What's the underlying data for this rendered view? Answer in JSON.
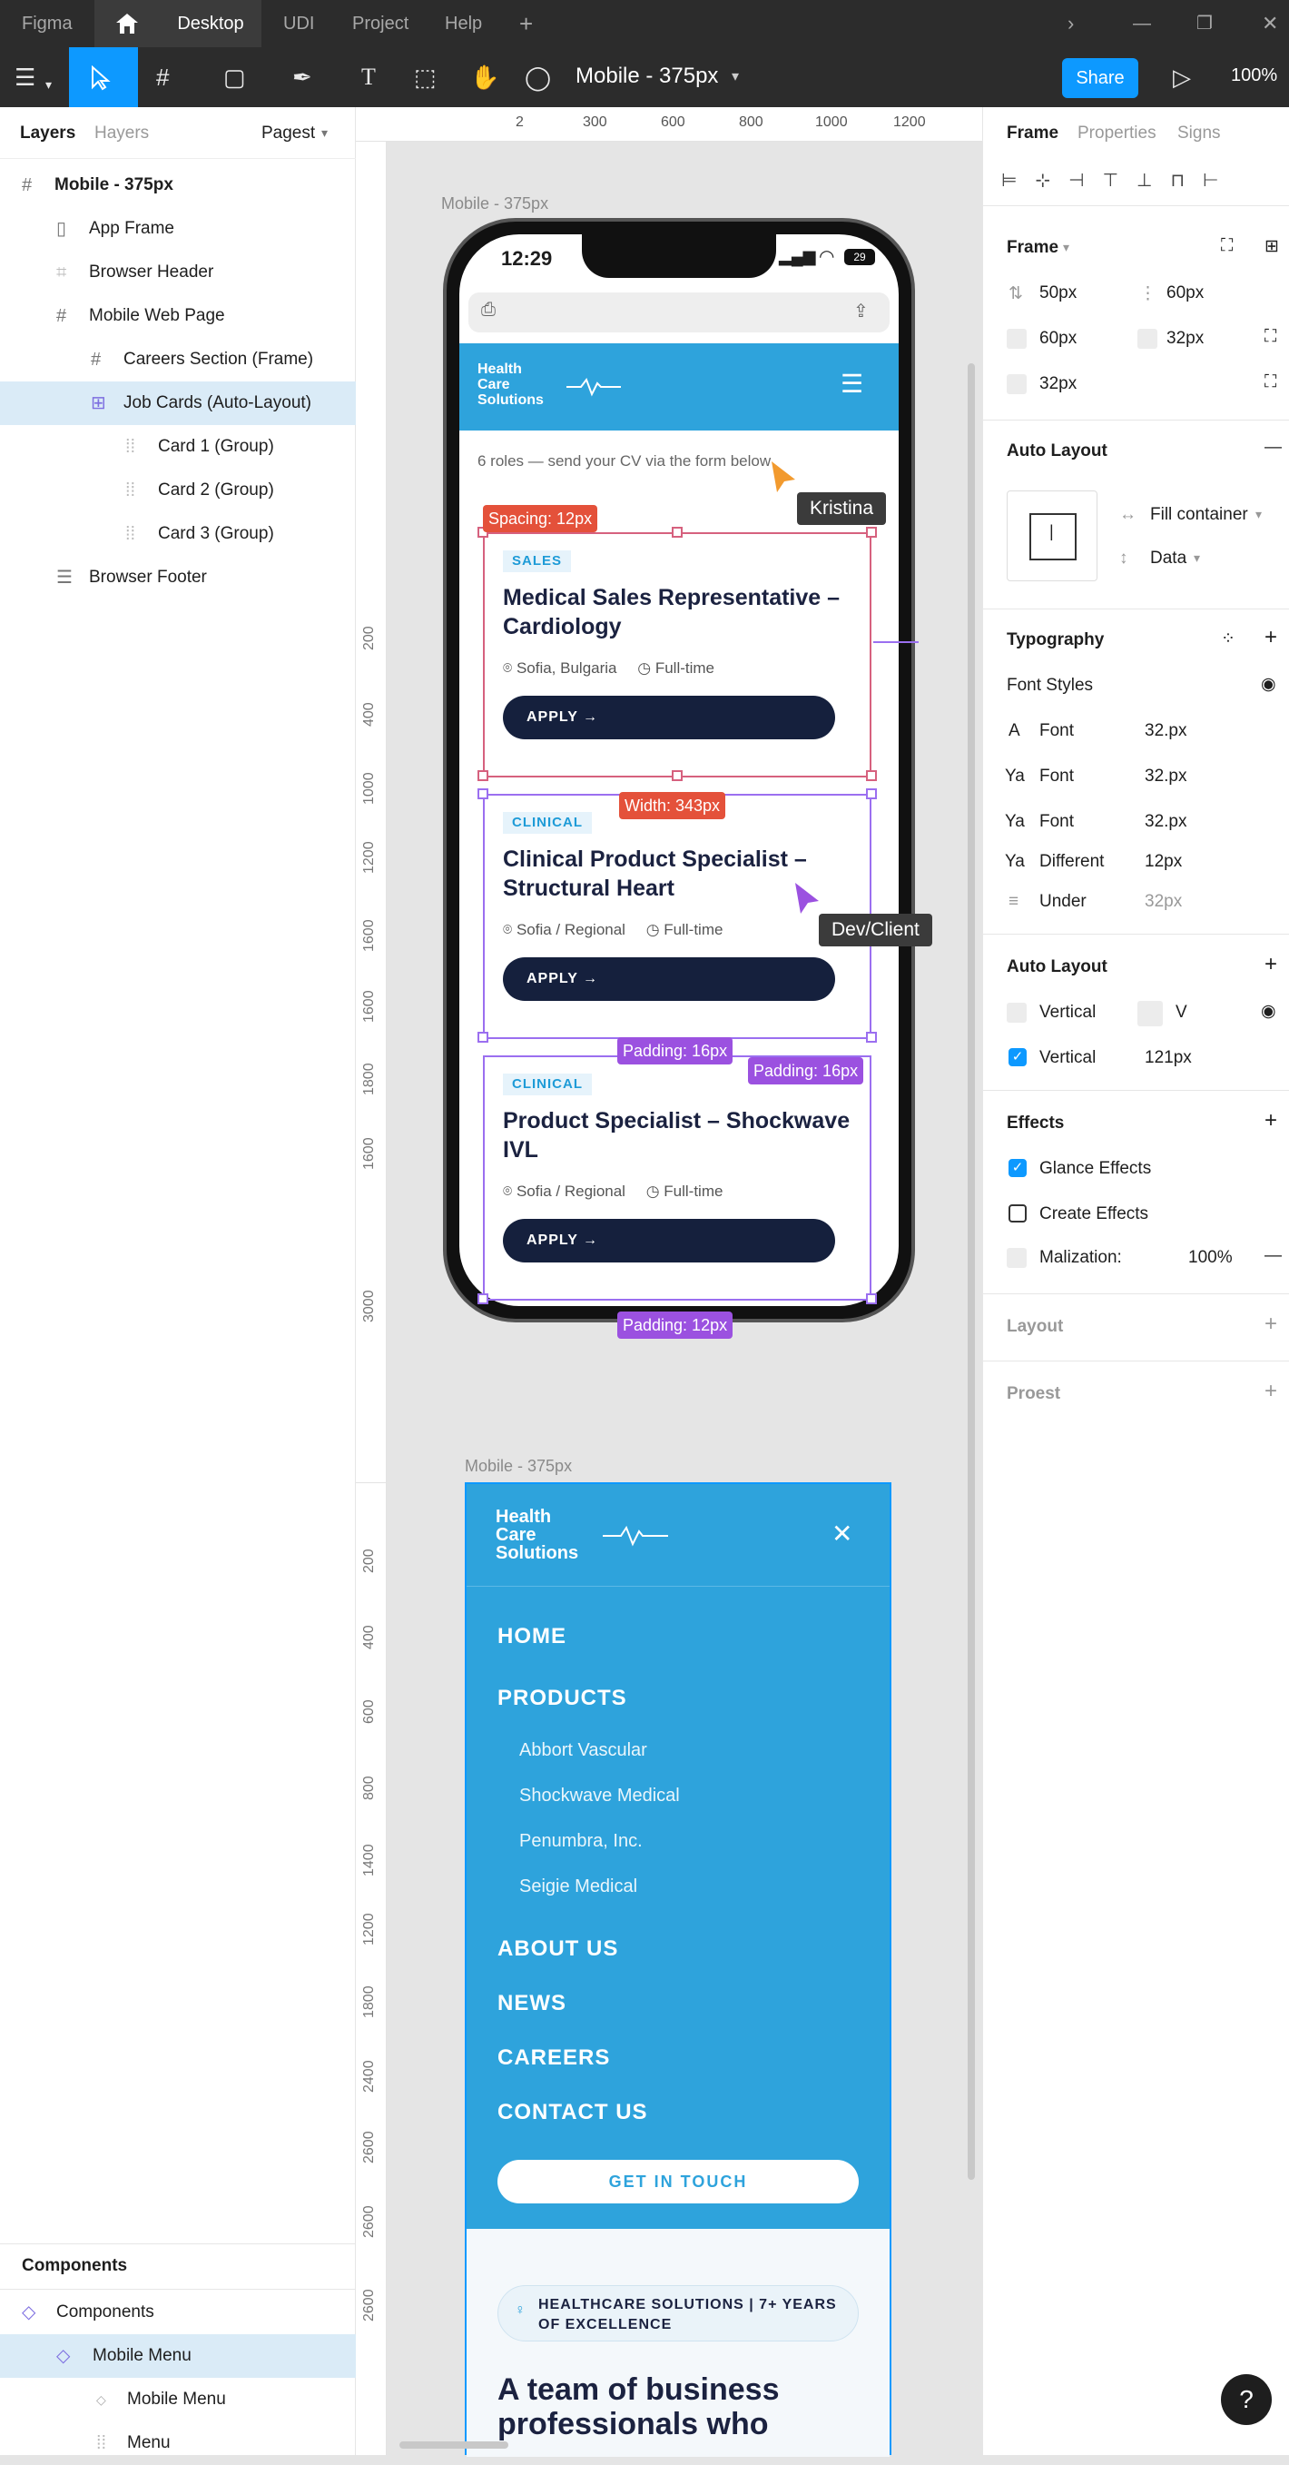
{
  "titlebar": {
    "app": "Figma",
    "tabs": [
      "Desktop",
      "UDI",
      "Project",
      "Help"
    ]
  },
  "toolbar": {
    "file_name": "Mobile - 375px",
    "share_label": "Share",
    "zoom": "100%"
  },
  "left_panel": {
    "tab_layers": "Layers",
    "tab_hayers": "Hayers",
    "page_select": "Pagest",
    "layers": [
      {
        "label": "Mobile - 375px",
        "icon": "frame-icon"
      },
      {
        "label": "App Frame",
        "icon": "phone-icon"
      },
      {
        "label": "Browser Header",
        "icon": "component-icon"
      },
      {
        "label": "Mobile Web Page",
        "icon": "frame-icon"
      },
      {
        "label": "Careers Section (Frame)",
        "icon": "frame-icon"
      },
      {
        "label": "Job Cards (Auto-Layout)",
        "icon": "auto-layout-icon"
      },
      {
        "label": "Card 1 (Group)",
        "icon": "group-icon"
      },
      {
        "label": "Card 2 (Group)",
        "icon": "group-icon"
      },
      {
        "label": "Card 3 (Group)",
        "icon": "group-icon"
      },
      {
        "label": "Browser Footer",
        "icon": "list-icon"
      }
    ],
    "components_heading": "Components",
    "components": [
      {
        "label": "Components"
      },
      {
        "label": "Mobile Menu"
      },
      {
        "label": "Mobile Menu"
      },
      {
        "label": "Menu"
      }
    ]
  },
  "ruler_top": [
    "2",
    "300",
    "600",
    "800",
    "1000",
    "1200"
  ],
  "ruler_left_upper": [
    "200",
    "400",
    "1000",
    "1200",
    "1600",
    "1600",
    "1800",
    "1600",
    "3000"
  ],
  "ruler_left_lower": [
    "200",
    "400",
    "600",
    "800",
    "1400",
    "1200",
    "1800",
    "2400",
    "2600",
    "2600",
    "2600"
  ],
  "canvas": {
    "frame1_label": "Mobile - 375px",
    "frame2_label": "Mobile - 375px",
    "phone": {
      "time": "12:29",
      "battery": "29",
      "brand_line1": "Health",
      "brand_line2": "Care",
      "brand_line3": "Solutions",
      "roles_text": "6 roles — send your CV via the form below",
      "cards": [
        {
          "tag": "SALES",
          "title": "Medical Sales Representative – Cardiology",
          "location": "Sofia, Bulgaria",
          "type": "Full-time",
          "cta": "APPLY"
        },
        {
          "tag": "CLINICAL",
          "title": "Clinical Product Specialist – Structural Heart",
          "location": "Sofia / Regional",
          "type": "Full-time",
          "cta": "APPLY"
        },
        {
          "tag": "CLINICAL",
          "title": "Product Specialist – Shockwave IVL",
          "location": "Sofia / Regional",
          "type": "Full-time",
          "cta": "APPLY"
        }
      ]
    },
    "measure": {
      "spacing": "Spacing: 12px",
      "width": "Width: 343px",
      "padding_a": "Padding: 16px",
      "padding_b": "Padding: 16px",
      "padding_c": "Padding: 12px"
    },
    "cursors": {
      "user1": "Kristina",
      "user2": "Dev/Client"
    },
    "menu": {
      "brand_line1": "Health",
      "brand_line2": "Care",
      "brand_line3": "Solutions",
      "items": [
        "HOME",
        "PRODUCTS",
        "ABOUT US",
        "NEWS",
        "CAREERS",
        "CONTACT US"
      ],
      "subitems": [
        "Abbort Vascular",
        "Shockwave Medical",
        "Penumbra, Inc.",
        "Seigie Medical"
      ],
      "cta": "GET IN TOUCH",
      "badge": "HEALTHCARE SOLUTIONS | 7+ YEARS OF EXCELLENCE",
      "headline_line1": "A team of business",
      "headline_line2": "professionals who"
    }
  },
  "right_panel": {
    "tabs": [
      "Frame",
      "Properties",
      "Signs"
    ],
    "frame_heading": "Frame",
    "frame_values": [
      "50px",
      "60px",
      "60px",
      "32px",
      "32px"
    ],
    "auto_layout_heading": "Auto Layout",
    "fill_container": "Fill container",
    "data_label": "Data",
    "typography_heading": "Typography",
    "font_styles": "Font Styles",
    "typo_rows": [
      {
        "label": "Font",
        "value": "32.px"
      },
      {
        "label": "Font",
        "value": "32.px"
      },
      {
        "label": "Font",
        "value": "32.px"
      },
      {
        "label": "Different",
        "value": "12px"
      },
      {
        "label": "Under",
        "value": "32px"
      }
    ],
    "auto_layout2_heading": "Auto Layout",
    "vertical1": "Vertical",
    "vertical1_value": "V",
    "vertical2": "Vertical",
    "vertical2_value": "121px",
    "effects_heading": "Effects",
    "effects": [
      {
        "label": "Glance Effects",
        "checked": true
      },
      {
        "label": "Create Effects",
        "checked": false
      }
    ],
    "malization_label": "Malization:",
    "malization_value": "100%",
    "layout_heading": "Layout",
    "proest_heading": "Proest"
  },
  "help_button": "?",
  "colors": {
    "accent": "#0d99ff",
    "brand_blue": "#2ea3dc",
    "navy": "#15203d",
    "measure_red": "#e4513a",
    "measure_purple": "#9b51e0"
  }
}
